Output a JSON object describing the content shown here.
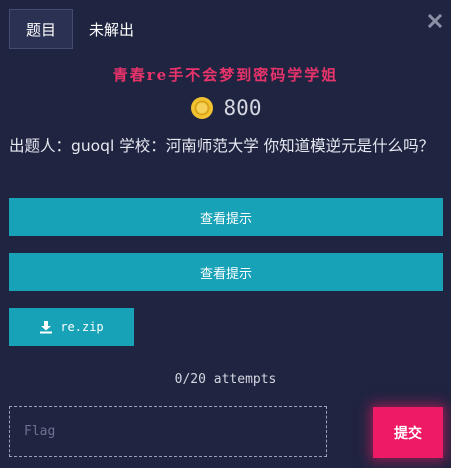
{
  "tabs": [
    {
      "label": "题目",
      "active": true
    },
    {
      "label": "未解出",
      "active": false
    }
  ],
  "challenge": {
    "title": "青春re手不会梦到密码学学姐",
    "points": "800",
    "description": "出题人：guoql 学校：河南师范大学 你知道模逆元是什么吗？"
  },
  "hints": [
    {
      "label": "查看提示"
    },
    {
      "label": "查看提示"
    }
  ],
  "attachment": {
    "filename": "re.zip",
    "icon": "download-icon"
  },
  "attempts": "0/20 attempts",
  "flag_input": {
    "value": "",
    "placeholder": "Flag"
  },
  "submit_label": "提交",
  "icons": {
    "close": "close-icon",
    "coin": "coin-icon"
  },
  "colors": {
    "background": "#1f2440",
    "accent_teal": "#17a2b8",
    "accent_pink": "#ee1a66",
    "title_pink": "#e8336b",
    "coin_gold": "#f2c230"
  }
}
